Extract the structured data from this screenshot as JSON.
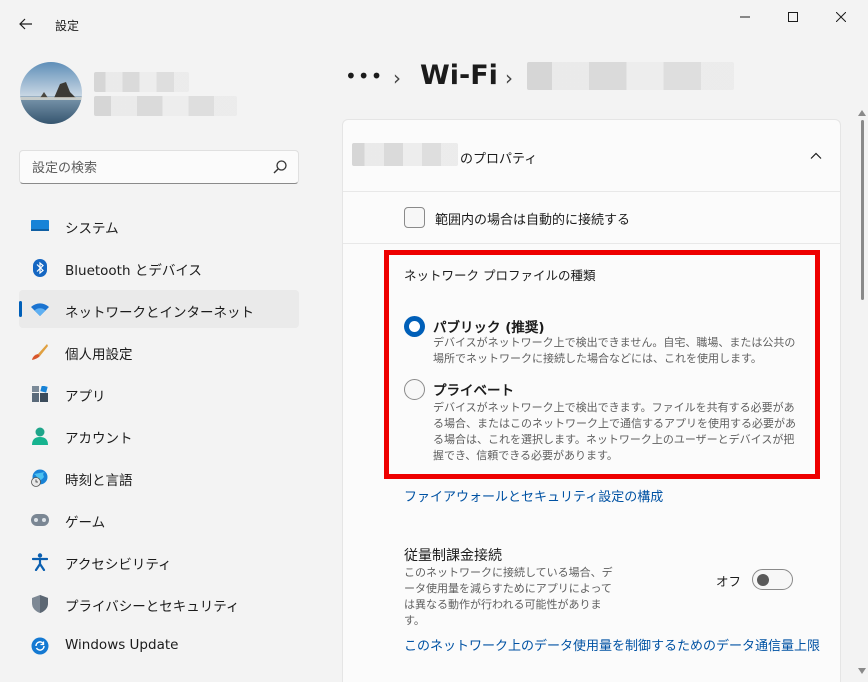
{
  "window": {
    "title": "設定"
  },
  "search": {
    "placeholder": "設定の検索"
  },
  "sidebar": {
    "items": [
      {
        "label": "システム",
        "icon": "monitor-icon"
      },
      {
        "label": "Bluetooth とデバイス",
        "icon": "bluetooth-icon"
      },
      {
        "label": "ネットワークとインターネット",
        "icon": "wifi-icon",
        "selected": true
      },
      {
        "label": "個人用設定",
        "icon": "brush-icon"
      },
      {
        "label": "アプリ",
        "icon": "apps-icon"
      },
      {
        "label": "アカウント",
        "icon": "person-icon"
      },
      {
        "label": "時刻と言語",
        "icon": "globe-clock-icon"
      },
      {
        "label": "ゲーム",
        "icon": "gamepad-icon"
      },
      {
        "label": "アクセシビリティ",
        "icon": "accessibility-icon"
      },
      {
        "label": "プライバシーとセキュリティ",
        "icon": "shield-icon"
      },
      {
        "label": "Windows Update",
        "icon": "update-icon"
      }
    ]
  },
  "breadcrumb": {
    "more": "•••",
    "current": "Wi-Fi"
  },
  "panel": {
    "props_label": "のプロパティ",
    "auto_connect_label": "範囲内の場合は自動的に接続する",
    "auto_connect_checked": false,
    "profile_section_title": "ネットワーク プロファイルの種類",
    "options": [
      {
        "title": "パブリック (推奨)",
        "desc": "デバイスがネットワーク上で検出できません。自宅、職場、または公共の場所でネットワークに接続した場合などには、これを使用します。",
        "selected": true
      },
      {
        "title": "プライベート",
        "desc": "デバイスがネットワーク上で検出できます。ファイルを共有する必要がある場合、またはこのネットワーク上で通信するアプリを使用する必要がある場合は、これを選択します。ネットワーク上のユーザーとデバイスが把握でき、信頼できる必要があります。",
        "selected": false
      }
    ],
    "firewall_link": "ファイアウォールとセキュリティ設定の構成",
    "metered": {
      "title": "従量制課金接続",
      "desc": "このネットワークに接続している場合、データ使用量を減らすためにアプリによっては異なる動作が行われる可能性があります。",
      "toggle_label": "オフ",
      "toggle_on": false
    },
    "data_limit_link": "このネットワーク上のデータ使用量を制御するためのデータ通信量上限"
  },
  "colors": {
    "accent": "#005fb8",
    "highlight_frame": "#ee0000",
    "link": "#0052a3"
  }
}
